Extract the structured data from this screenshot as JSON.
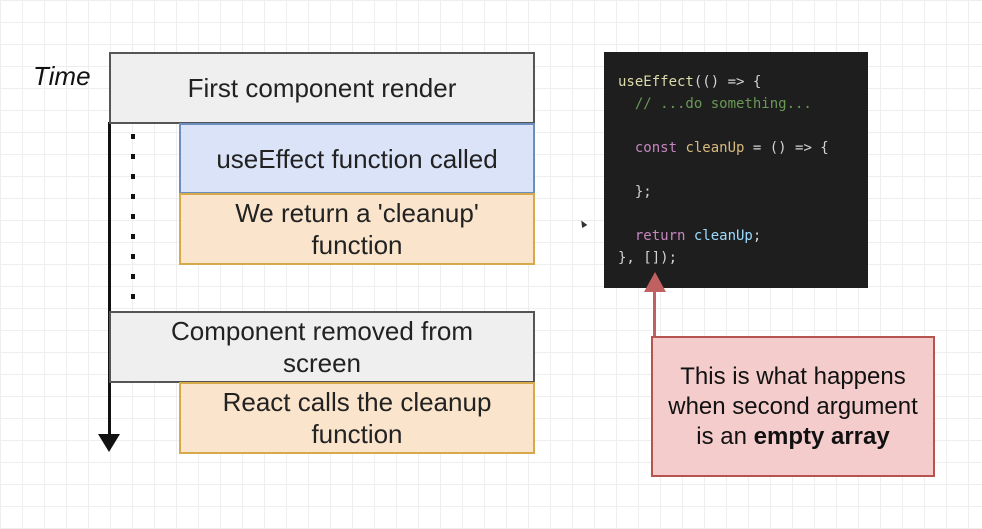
{
  "time_label": "Time",
  "boxes": {
    "first_render": "First component render",
    "useeffect_called": "useEffect function called",
    "return_cleanup": "We return a 'cleanup' function",
    "component_removed": "Component removed from screen",
    "react_calls_cleanup": "React calls the cleanup function"
  },
  "code": {
    "line1_fn": "useEffect",
    "line1_rest": "(() => {",
    "line2_comment": "  // ...do something...",
    "line4_kw": "  const ",
    "line4_var": "cleanUp",
    "line4_rest": " = () => {",
    "line6": "  };",
    "line8_kw": "  return ",
    "line8_var": "cleanUp",
    "line8_end": ";",
    "line9": "}, []);"
  },
  "callout": {
    "text_before": "This is what happens when second argument is an ",
    "text_bold": "empty array"
  },
  "colors": {
    "gray_box": "#efefef",
    "blue_box": "#dae3f7",
    "orange_box": "#fae5cc",
    "callout_bg": "#f4cccc",
    "code_bg": "#1e1e1e"
  }
}
